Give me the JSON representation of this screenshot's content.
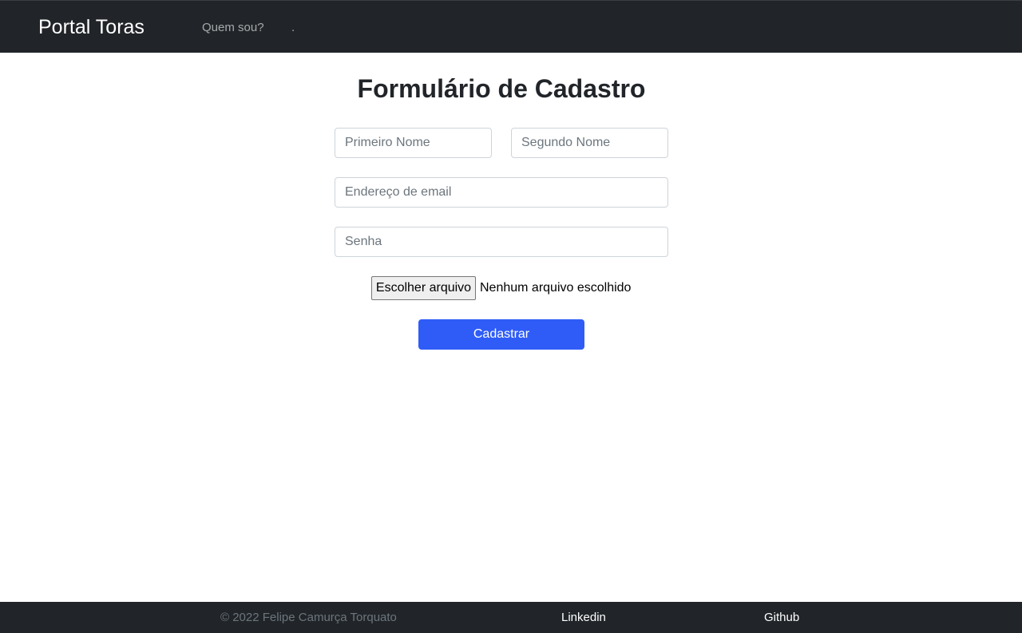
{
  "navbar": {
    "brand": "Portal Toras",
    "links": [
      {
        "label": "Quem sou?"
      },
      {
        "label": "."
      }
    ]
  },
  "form": {
    "title": "Formulário de Cadastro",
    "first_name": {
      "placeholder": "Primeiro Nome",
      "value": ""
    },
    "last_name": {
      "placeholder": "Segundo Nome",
      "value": ""
    },
    "email": {
      "placeholder": "Endereço de email",
      "value": ""
    },
    "password": {
      "placeholder": "Senha",
      "value": ""
    },
    "file": {
      "button_label": "Escolher arquivo",
      "status": "Nenhum arquivo escolhido"
    },
    "submit_label": "Cadastrar"
  },
  "footer": {
    "copyright": "© 2022 Felipe Camurça Torquato",
    "links": [
      {
        "label": "Linkedin"
      },
      {
        "label": "Github"
      }
    ]
  },
  "colors": {
    "navbar_bg": "#212529",
    "primary_button": "#2f5cf7",
    "footer_bg": "#212529"
  }
}
